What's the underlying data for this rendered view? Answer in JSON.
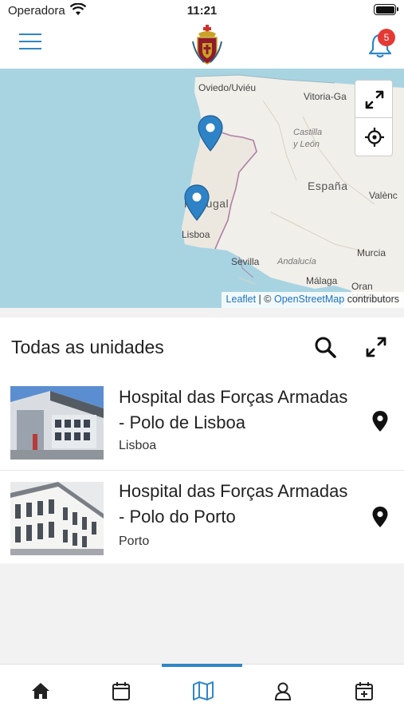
{
  "status_bar": {
    "carrier": "Operadora",
    "time": "11:21"
  },
  "header": {
    "notification_count": "5"
  },
  "map": {
    "labels": {
      "oviedo": "Oviedo/Uviéu",
      "vitoria": "Vitoria-Ga",
      "castilla": "Castilla",
      "leon": "y León",
      "espana": "España",
      "valencia": "Valènc",
      "portugal": "Portugal",
      "lisboa": "Lisboa",
      "sevilla": "Sevilla",
      "andalucia": "Andalucía",
      "murcia": "Murcia",
      "malaga": "Málaga",
      "oran": "Oran ⵡⵀⵕⴰⵏ"
    },
    "attribution": {
      "leaflet": "Leaflet",
      "separator": " | © ",
      "osm": "OpenStreetMap",
      "suffix": " contributors"
    }
  },
  "list": {
    "title": "Todas as unidades",
    "units": [
      {
        "name": "Hospital das Forças Armadas - Polo de Lisboa",
        "city": "Lisboa"
      },
      {
        "name": "Hospital das Forças Armadas - Polo do Porto",
        "city": "Porto"
      }
    ]
  },
  "tabbar": {
    "tabs": [
      {
        "icon": "home-icon"
      },
      {
        "icon": "calendar-icon"
      },
      {
        "icon": "map-icon",
        "active": true
      },
      {
        "icon": "user-icon"
      },
      {
        "icon": "calendar-plus-icon"
      }
    ]
  },
  "colors": {
    "accent": "#2f86c7",
    "badge": "#e53935",
    "water": "#a8d4e2",
    "land": "#f1efe9"
  }
}
